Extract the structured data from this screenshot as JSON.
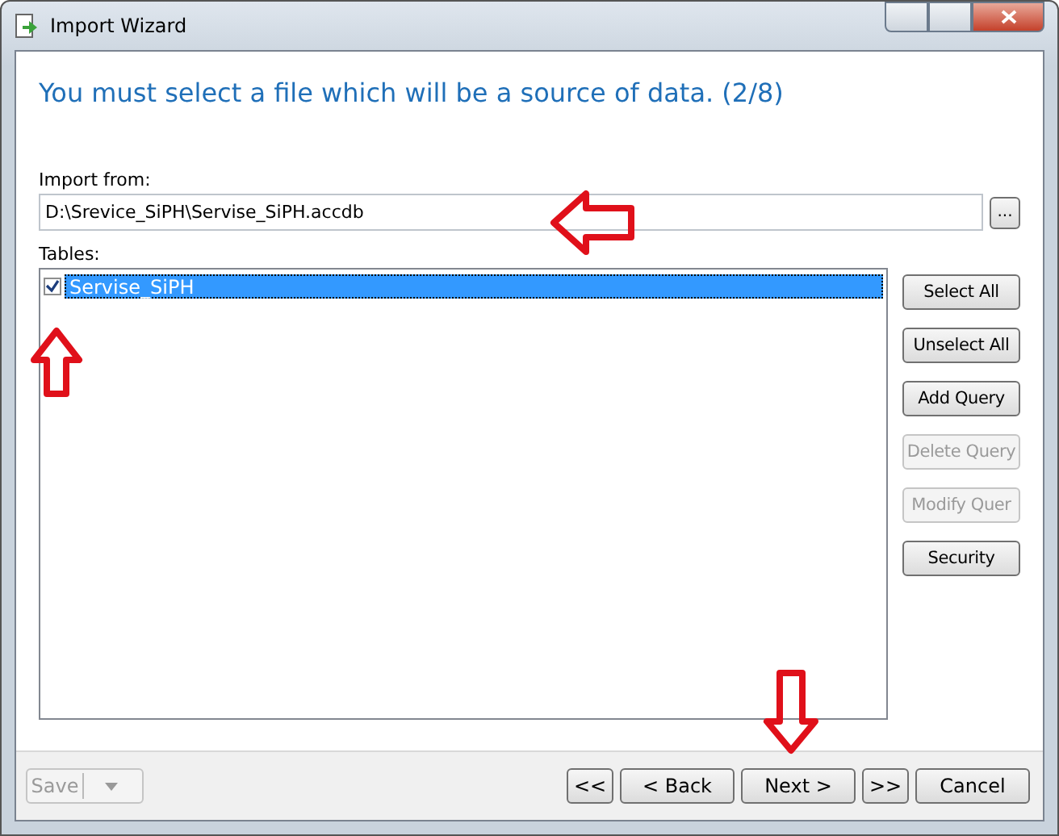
{
  "window": {
    "title": "Import Wizard"
  },
  "heading": "You must select a file which will be a source of data. (2/8)",
  "import_from": {
    "label": "Import from:",
    "value": "D:\\Srevice_SiPH\\Servise_SiPH.accdb",
    "browse": "..."
  },
  "tables": {
    "label": "Tables:",
    "items": [
      {
        "name": "Servise_SiPH",
        "checked": true,
        "selected": true
      }
    ]
  },
  "side_buttons": [
    {
      "label": "Select All",
      "disabled": false
    },
    {
      "label": "Unselect All",
      "disabled": false
    },
    {
      "label": "Add Query",
      "disabled": false
    },
    {
      "label": "Delete Query",
      "disabled": true
    },
    {
      "label": "Modify Quer",
      "disabled": true
    },
    {
      "label": "Security",
      "disabled": false
    }
  ],
  "save_button": {
    "label": "Save",
    "disabled": true
  },
  "nav_buttons": [
    {
      "label": "<<"
    },
    {
      "label": "< Back"
    },
    {
      "label": "Next >"
    },
    {
      "label": ">>"
    },
    {
      "label": "Cancel"
    }
  ],
  "annotations": [
    {
      "kind": "left"
    },
    {
      "kind": "up"
    },
    {
      "kind": "down"
    }
  ]
}
